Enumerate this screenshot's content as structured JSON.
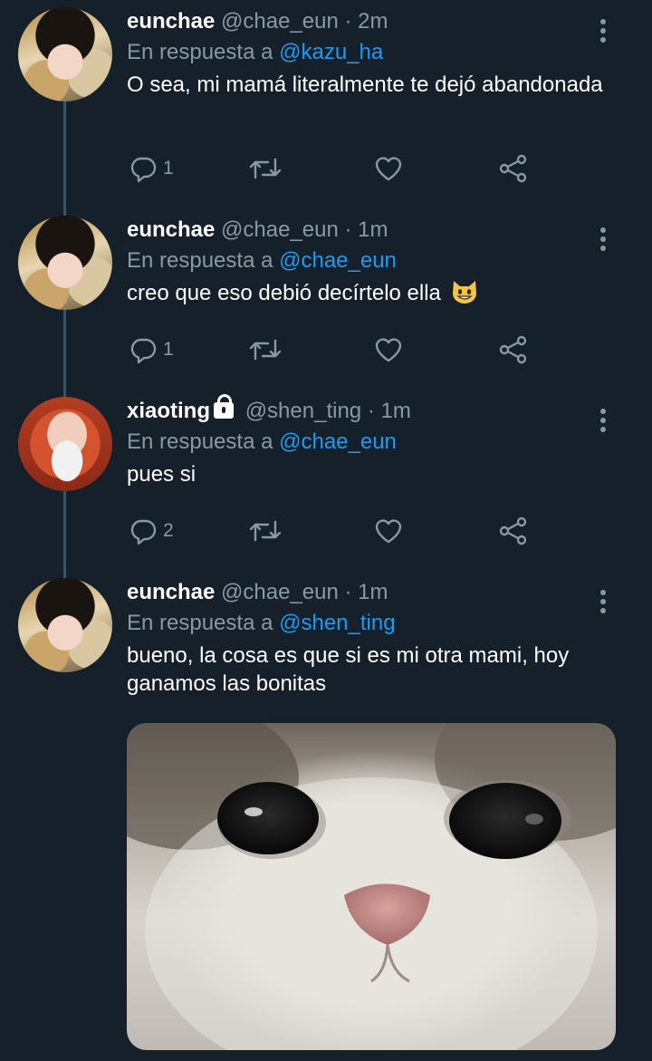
{
  "tweets": [
    {
      "name": "eunchae",
      "handle": "@chae_eun",
      "time": "· 2m",
      "reply_prefix": "En respuesta a",
      "reply_to": "@kazu_ha",
      "text": "O sea, mi mamá literalmente te dejó abandonada",
      "replies": "1"
    },
    {
      "name": "eunchae",
      "handle": "@chae_eun",
      "time": "· 1m",
      "reply_prefix": "En respuesta a",
      "reply_to": "@chae_eun",
      "text": "creo que eso debió decírtelo ella",
      "replies": "1"
    },
    {
      "name": "xiaoting",
      "handle": "@shen_ting",
      "time": "· 1m",
      "reply_prefix": "En respuesta a",
      "reply_to": "@chae_eun",
      "text": "pues si",
      "replies": "2"
    },
    {
      "name": "eunchae",
      "handle": "@chae_eun",
      "time": "· 1m",
      "reply_prefix": "En respuesta a",
      "reply_to": "@shen_ting",
      "text": "bueno, la cosa es que si es mi otra mami, hoy ganamos las bonitas",
      "replies": ""
    }
  ],
  "icons": {
    "reply": "reply-icon",
    "retweet": "retweet-icon",
    "like": "like-icon",
    "share": "share-icon",
    "more": "more-icon",
    "lock": "lock-icon",
    "emoji": "grinning-cat-emoji"
  },
  "colors": {
    "background": "#15202b",
    "link": "#1d9bf0",
    "muted": "#8899a6",
    "thread_line": "#3d5466"
  }
}
